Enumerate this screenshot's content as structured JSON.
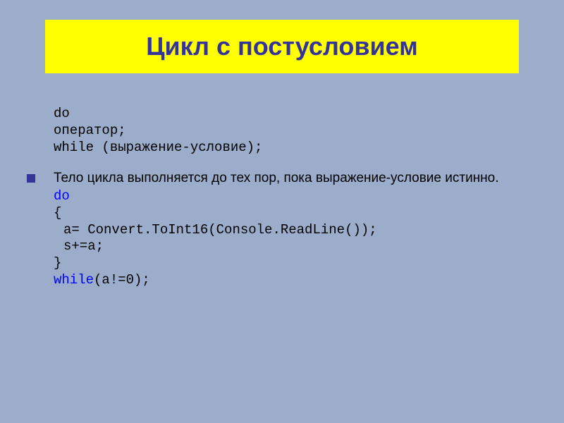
{
  "title": "Цикл с постусловием",
  "syntax": {
    "l1": "do",
    "l2": "оператор;",
    "l3": "while (выражение-условие);"
  },
  "para": "Тело цикла выполняется до тех пор, пока выражение-условие истинно.",
  "code": {
    "kw_do": "do",
    "brace_open": "{",
    "line_a": "a= Convert.ToInt16(Console.ReadLine());",
    "line_s": "s+=a;",
    "brace_close": "}",
    "kw_while": "while",
    "while_rest_1": "(a!=",
    "while_zero": "0",
    "while_rest_2": ");"
  }
}
